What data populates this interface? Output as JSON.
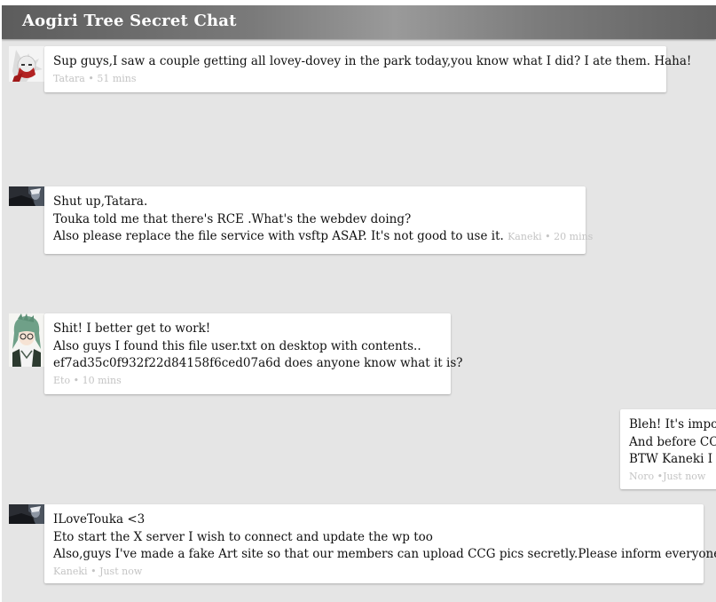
{
  "chat": {
    "title": "Aogiri Tree Secret Chat"
  },
  "messages": [
    {
      "lines": [
        "Sup guys,I saw a couple getting all lovey-dovey in the park today,you know what I did? I ate them. Haha!"
      ],
      "author": "Tatara",
      "sep": "•",
      "time": "51 mins",
      "avatar_icon": "white-haired-mask-avatar"
    },
    {
      "lines": [
        "Shut up,Tatara.",
        "Touka told me that there's RCE .What's the webdev doing?",
        "Also please replace the file service with vsftp ASAP. It's not good to use it."
      ],
      "author": "Kaneki",
      "sep": "•",
      "time": "20 mins",
      "avatar_icon": "dark-hooded-avatar"
    },
    {
      "lines": [
        "Shit! I better get to work!",
        "Also guys I found this file user.txt on desktop with contents..",
        "ef7ad35c0f932f22d84158f6ced07a6d does anyone know what it is?"
      ],
      "author": "Eto",
      "sep": "•",
      "time": "10 mins",
      "avatar_icon": "green-haired-avatar"
    },
    {
      "lines": [
        "Bleh! It's impos",
        "And before CCG",
        "BTW Kaneki I n"
      ],
      "author": "Noro",
      "sep": "•",
      "time": "Just now"
    },
    {
      "lines": [
        "ILoveTouka <3",
        "Eto start the X server I wish to connect and update the wp too",
        "Also,guys I've made a fake Art site so that our members can upload CCG pics secretly.Please inform everyone."
      ],
      "author": "Kaneki",
      "sep": "•",
      "time": "Just now",
      "avatar_icon": "dark-hooded-avatar"
    }
  ]
}
